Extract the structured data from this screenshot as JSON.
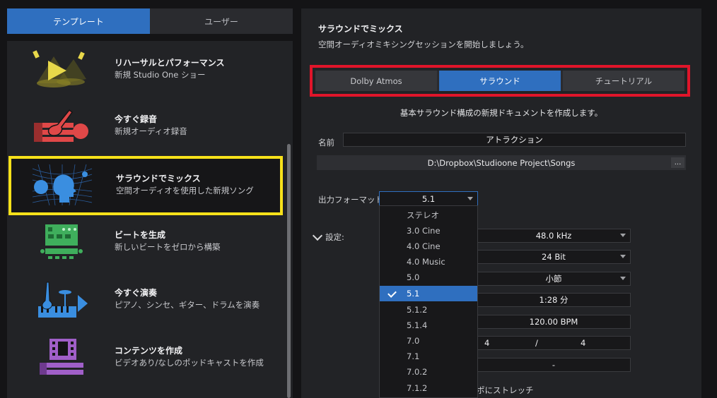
{
  "left_tabs": [
    {
      "label": "テンプレート",
      "active": true
    },
    {
      "label": "ユーザー",
      "active": false
    }
  ],
  "templates": [
    {
      "title": "リハーサルとパフォーマンス",
      "subtitle": "新規 Studio One ショー",
      "icon": "stage-spotlight-icon",
      "color": "#e8d84a"
    },
    {
      "title": "今すぐ録音",
      "subtitle": "新規オーディオ録音",
      "icon": "guitar-record-icon",
      "color": "#e04848"
    },
    {
      "title": "サラウンドでミックス",
      "subtitle": "空間オーディオを使用した新規ソング",
      "icon": "spatial-head-icon",
      "color": "#3a8ee0",
      "selected": true
    },
    {
      "title": "ビートを生成",
      "subtitle": "新しいビートをゼロから構築",
      "icon": "beat-pad-icon",
      "color": "#3fae5c"
    },
    {
      "title": "今すぐ演奏",
      "subtitle": "ピアノ、シンセ、ギター、ドラムを演奏",
      "icon": "instruments-play-icon",
      "color": "#3a8ee0"
    },
    {
      "title": "コンテンツを作成",
      "subtitle": "ビデオあり/なしのポッドキャストを作成",
      "icon": "film-content-icon",
      "color": "#a05fc8"
    }
  ],
  "panel": {
    "title": "サラウンドでミックス",
    "subtitle": "空間オーディオミキシングセッションを開始しましょう。",
    "modes": [
      {
        "label": "Dolby Atmos",
        "active": false
      },
      {
        "label": "サラウンド",
        "active": true
      },
      {
        "label": "チュートリアル",
        "active": false
      }
    ],
    "description": "基本サラウンド構成の新規ドキュメントを作成します。",
    "name_label": "名前",
    "name_value": "アトラクション",
    "path": "D:\\Dropbox\\Studioone Project\\Songs",
    "path_more": "...",
    "output_format_label": "出力フォーマット",
    "output_format_value": "5.1",
    "settings_label": "設定:",
    "sample_rate": "48.0 kHz",
    "bit_depth": "24 Bit",
    "timebase": "小節",
    "length": "1:28 分",
    "tempo": "120.00 BPM",
    "time_sig_num": "4",
    "time_sig_sep": "/",
    "time_sig_den": "4",
    "key": "-",
    "stretch_label": "ポにストレッチ"
  },
  "dropdown": {
    "options": [
      "ステレオ",
      "3.0 Cine",
      "4.0 Cine",
      "4.0 Music",
      "5.0",
      "5.1",
      "5.1.2",
      "5.1.4",
      "7.0",
      "7.1",
      "7.0.2",
      "7.1.2"
    ],
    "selected": "5.1"
  },
  "colors": {
    "accent": "#2f6fbf",
    "highlight_yellow": "#f7e11a",
    "highlight_red": "#e0152a"
  }
}
